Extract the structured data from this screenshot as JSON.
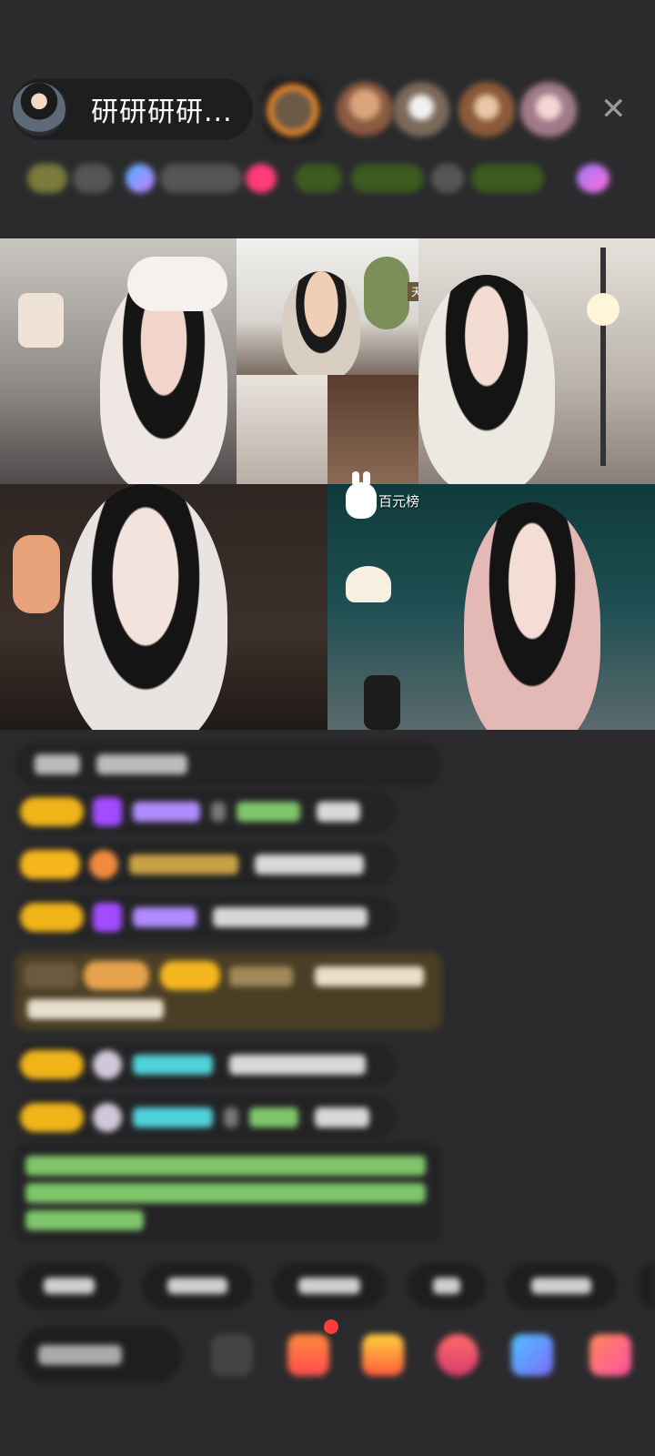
{
  "header": {
    "host_name": "研研研研...",
    "close_label": "✕",
    "viewer_count": 5
  },
  "video": {
    "rank_label": "百元榜",
    "small_tag": "天榜"
  },
  "chat": {
    "message_count": 8
  },
  "bottom": {
    "quick_reply_count": 6,
    "tool_count": 6
  },
  "colors": {
    "background": "#2b2b2d",
    "pill": "#1e1e20",
    "level_badge": "#f0b419",
    "username_purple": "#b08cff",
    "username_green": "#7fc56a",
    "username_cyan": "#4fd1d9",
    "system_text_green": "#7fc56a",
    "gift_banner": "#4a3e24"
  },
  "icons": {
    "close": "close-icon",
    "gift": "gift-icon",
    "emoji": "emoji-icon"
  }
}
